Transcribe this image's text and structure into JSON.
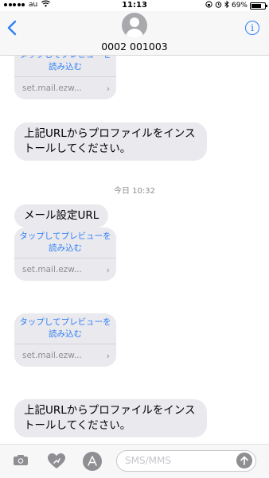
{
  "status": {
    "carrier": "au",
    "time": "11:13",
    "battery": "69%"
  },
  "header": {
    "contact": "0002 001003",
    "info_glyph": "i"
  },
  "messages": {
    "link1": {
      "preview": "タップしてプレビューを読み込む",
      "url": "set.mail.ezw..."
    },
    "text1": "上記URLからプロファイルをインストールしてください。",
    "timestamp": "今日 10:32",
    "text2": "メール設定URL",
    "link2": {
      "preview": "タップしてプレビューを読み込む",
      "url": "set.mail.ezw..."
    },
    "link3": {
      "preview": "タップしてプレビューを読み込む",
      "url": "set.mail.ezw..."
    },
    "text3": "上記URLからプロファイルをインストールしてください。"
  },
  "compose": {
    "placeholder": "SMS/MMS"
  },
  "colors": {
    "accent": "#2f7ff6",
    "bubble": "#e9e9ee",
    "muted": "#8e8e93"
  }
}
